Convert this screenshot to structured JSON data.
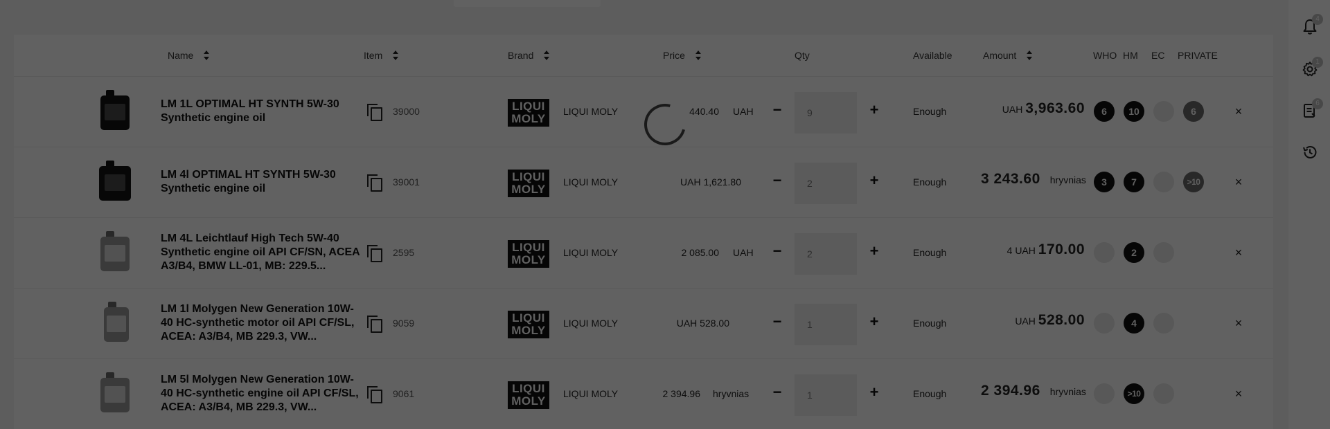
{
  "header": {
    "name": "Name",
    "item": "Item",
    "brand": "Brand",
    "price": "Price",
    "qty": "Qty",
    "available": "Available",
    "amount": "Amount",
    "who": "WHO",
    "hm": "HM",
    "ec": "EC",
    "private": "PRIVATE"
  },
  "rows": [
    {
      "name": "LM 1L OPTIMAL HT SYNTH 5W-30 Synthetic engine oil",
      "item": "39000",
      "brand_logo": "LIQUI MOLY",
      "brand": "LIQUI MOLY",
      "price_num": "440.40",
      "price_cur": "UAH",
      "qty": "9",
      "available": "Enough",
      "amount_pre": "UAH",
      "amount_num": "3,963.60",
      "amount_cur": "",
      "who": "6",
      "hm": "10",
      "ec": "0",
      "private": "6"
    },
    {
      "name": "LM 4l OPTIMAL HT SYNTH 5W-30 Synthetic engine oil",
      "item": "39001",
      "brand_logo": "LIQUI MOLY",
      "brand": "LIQUI MOLY",
      "price_num": "UAH 1,621.80",
      "price_cur": "",
      "qty": "2",
      "available": "Enough",
      "amount_pre": "",
      "amount_num": "3 243.60",
      "amount_cur": "hryvnias",
      "who": "3",
      "hm": "7",
      "ec": "0",
      "private": ">10"
    },
    {
      "name": "LM 4L Leichtlauf High Tech 5W-40 Synthetic engine oil API CF/SN, ACEA A3/B4, BMW LL-01, MB: 229.5...",
      "item": "2595",
      "brand_logo": "LIQUI MOLY",
      "brand": "LIQUI MOLY",
      "price_num": "2 085.00",
      "price_cur": "UAH",
      "qty": "2",
      "available": "Enough",
      "amount_pre": "4 UAH",
      "amount_num": "170.00",
      "amount_cur": "",
      "who": "0",
      "hm": "2",
      "ec": "0",
      "private": ""
    },
    {
      "name": "LM 1l Molygen New Generation 10W-40 HC-synthetic motor oil API CF/SL, ACEA: A3/B4, MB 229.3, VW...",
      "item": "9059",
      "brand_logo": "LIQUI MOLY",
      "brand": "LIQUI MOLY",
      "price_num": "UAH 528.00",
      "price_cur": "",
      "qty": "1",
      "available": "Enough",
      "amount_pre": "UAH",
      "amount_num": "528.00",
      "amount_cur": "",
      "who": "0",
      "hm": "4",
      "ec": "0",
      "private": ""
    },
    {
      "name": "LM 5l Molygen New Generation 10W-40 HC-synthetic engine oil API CF/SL, ACEA: A3/B4, MB 229.3, VW...",
      "item": "9061",
      "brand_logo": "LIQUI MOLY",
      "brand": "LIQUI MOLY",
      "price_num": "2 394.96",
      "price_cur": "hryvnias",
      "qty": "1",
      "available": "Enough",
      "amount_pre": "",
      "amount_num": "2 394.96",
      "amount_cur": "hryvnias",
      "who": "0",
      "hm": ">10",
      "ec": "0",
      "private": ""
    }
  ],
  "controls": {
    "minus": "−",
    "plus": "+",
    "remove": "×"
  },
  "sidebar_right": {
    "notifications_count": "4",
    "settings_count": "1",
    "orders_count": "6"
  },
  "colors": {
    "overlay": "rgba(0,0,0,0.62)",
    "badge_dark": "#111111",
    "badge_dim": "#e6e6e6"
  }
}
